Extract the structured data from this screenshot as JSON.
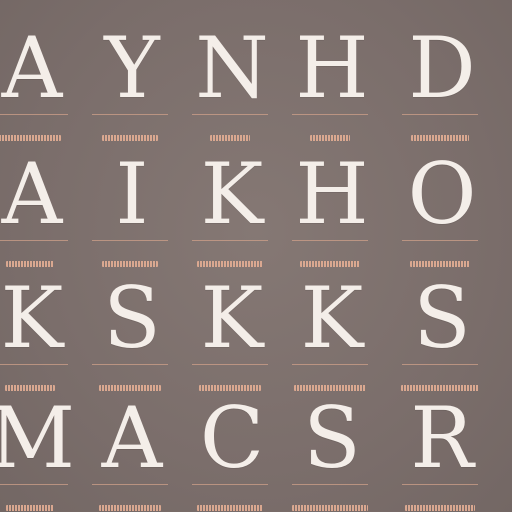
{
  "sheet": {
    "rows": [
      [
        "A",
        "Y",
        "N",
        "H",
        "D"
      ],
      [
        "A",
        "I",
        "K",
        "H",
        "O"
      ],
      [
        "K",
        "S",
        "K",
        "K",
        "S"
      ],
      [
        "M",
        "A",
        "C",
        "S",
        "R"
      ]
    ]
  },
  "colors": {
    "background": "#7d706d",
    "glyph": "#f4eee9",
    "caption": "#e6b39a",
    "rule": "#cfa08a"
  }
}
